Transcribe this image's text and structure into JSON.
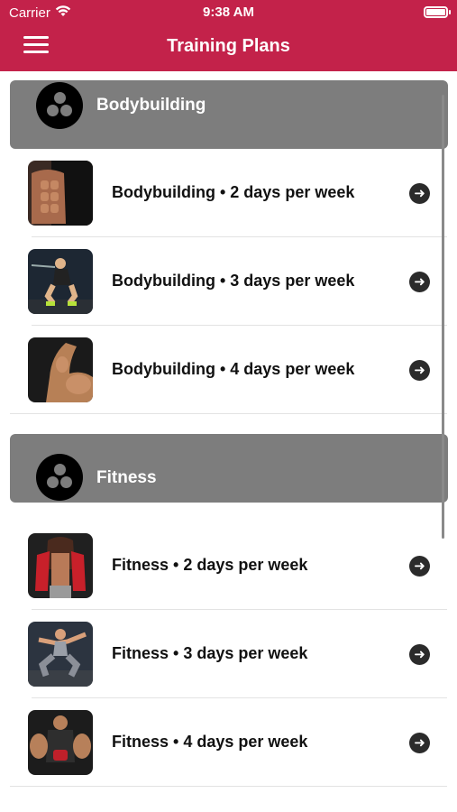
{
  "status_bar": {
    "carrier": "Carrier",
    "time": "9:38 AM",
    "wifi_icon": "wifi-icon",
    "battery_icon": "battery-icon"
  },
  "nav_bar": {
    "title": "Training Plans",
    "menu_icon": "hamburger-menu-icon",
    "color": "#c3224a"
  },
  "sections": [
    {
      "title": "Bodybuilding",
      "icon": "three-dot-circle-icon",
      "items": [
        {
          "label": "Bodybuilding • 2 days per week",
          "thumbnail": "abs-photo",
          "arrow_icon": "arrow-right-circle-icon"
        },
        {
          "label": "Bodybuilding • 3 days per week",
          "thumbnail": "squat-photo",
          "arrow_icon": "arrow-right-circle-icon"
        },
        {
          "label": "Bodybuilding • 4 days per week",
          "thumbnail": "biceps-photo",
          "arrow_icon": "arrow-right-circle-icon"
        }
      ]
    },
    {
      "title": "Fitness",
      "icon": "three-dot-circle-icon",
      "items": [
        {
          "label": "Fitness • 2 days per week",
          "thumbnail": "jacket-abs-photo",
          "arrow_icon": "arrow-right-circle-icon"
        },
        {
          "label": "Fitness • 3 days per week",
          "thumbnail": "squat-jump-photo",
          "arrow_icon": "arrow-right-circle-icon"
        },
        {
          "label": "Fitness • 4 days per week",
          "thumbnail": "arms-photo",
          "arrow_icon": "arrow-right-circle-icon"
        }
      ]
    }
  ],
  "colors": {
    "accent": "#c3224a",
    "section_header": "#7d7d7d",
    "arrow": "#2b2b2b"
  }
}
